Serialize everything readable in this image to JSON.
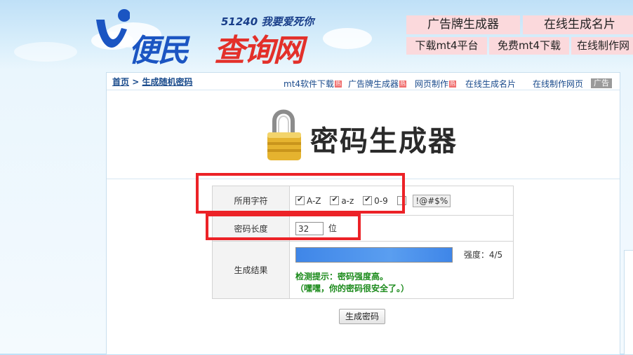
{
  "logo": {
    "slogan": "51240 我要爱死你",
    "name_part1": "便民",
    "name_part2": "查询网"
  },
  "top_links": {
    "row1": [
      "广告牌生成器",
      "在线生成名片"
    ],
    "row2": [
      "下载mt4平台",
      "免费mt4下载",
      "在线制作网"
    ]
  },
  "breadcrumb": {
    "home": "首页",
    "separator": ">",
    "current": "生成随机密码"
  },
  "subnav": [
    {
      "label": "mt4软件下载",
      "hot": "热"
    },
    {
      "label": "广告牌生成器",
      "hot": "热"
    },
    {
      "label": "网页制作",
      "hot": "热"
    },
    {
      "label": "在线生成名片",
      "hot": ""
    },
    {
      "label": "在线制作网页",
      "hot": ""
    }
  ],
  "ad_tag": "广告",
  "hero": {
    "title": "密码生成器",
    "icon": "padlock-icon"
  },
  "form": {
    "charset_label": "所用字符",
    "options": [
      {
        "label": "A-Z",
        "checked": true
      },
      {
        "label": "a-z",
        "checked": true
      },
      {
        "label": "0-9",
        "checked": true
      },
      {
        "label": "!@#$%",
        "checked": false
      }
    ],
    "length_label": "密码长度",
    "length_value": "32",
    "length_unit": "位",
    "result_label": "生成结果",
    "strength": "强度：4/5",
    "hint_line1": "检测提示：密码强度高。",
    "hint_line2": "（嘿嘿，你的密码很安全了。）"
  },
  "generate_button": "生成密码",
  "colors": {
    "highlight_box": "#ec2227",
    "link": "#1a4b8c",
    "hint": "#1a8a1a",
    "top_link_bg": "#fbd9dc"
  }
}
